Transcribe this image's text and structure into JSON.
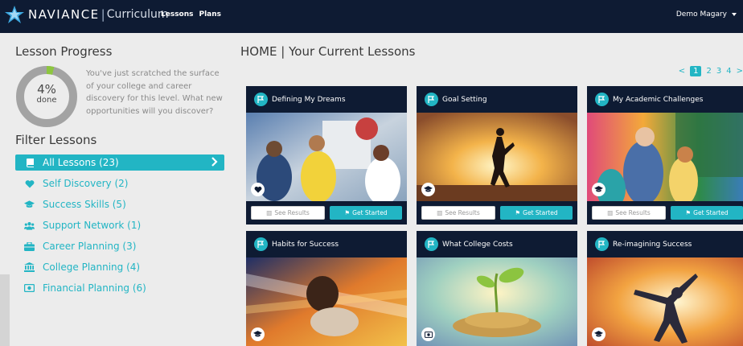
{
  "app": {
    "brand": "NAVIANCE",
    "separator": "|",
    "product": "Curriculum",
    "nav": [
      "Lessons",
      "Plans"
    ],
    "user": "Demo Magary"
  },
  "sidebar": {
    "progress_title": "Lesson Progress",
    "progress_value": 4,
    "progress_percent": "4%",
    "progress_label": "done",
    "progress_message": "You've just scratched the surface of your college and career discovery for this level. What new opportunities will you discover?",
    "filter_title": "Filter Lessons",
    "filters": [
      {
        "label": "All Lessons (23)",
        "icon": "book-icon",
        "active": true
      },
      {
        "label": "Self Discovery (2)",
        "icon": "heart-icon",
        "active": false
      },
      {
        "label": "Success Skills (5)",
        "icon": "graduation-cap-icon",
        "active": false
      },
      {
        "label": "Support Network (1)",
        "icon": "people-icon",
        "active": false
      },
      {
        "label": "Career Planning (3)",
        "icon": "briefcase-icon",
        "active": false
      },
      {
        "label": "College Planning (4)",
        "icon": "institution-icon",
        "active": false
      },
      {
        "label": "Financial Planning (6)",
        "icon": "money-icon",
        "active": false
      }
    ]
  },
  "main": {
    "title": "HOME | Your Current Lessons",
    "pagination": {
      "prev": "<",
      "pages": [
        "1",
        "2",
        "3",
        "4"
      ],
      "next": ">",
      "current": "1"
    },
    "see_results_label": "See Results",
    "get_started_label": "Get Started",
    "cards": [
      {
        "title": "Defining My Dreams",
        "category_icon": "heart-icon"
      },
      {
        "title": "Goal Setting",
        "category_icon": "graduation-cap-icon"
      },
      {
        "title": "My Academic Challenges",
        "category_icon": "graduation-cap-icon"
      },
      {
        "title": "Habits for Success",
        "category_icon": "graduation-cap-icon"
      },
      {
        "title": "What College Costs",
        "category_icon": "money-icon"
      },
      {
        "title": "Re-imagining Success",
        "category_icon": "graduation-cap-icon"
      }
    ]
  },
  "colors": {
    "navy": "#0e1b33",
    "teal": "#22b5c4",
    "progress_ring": "#a3a3a3",
    "progress_fill": "#8dc63f"
  }
}
